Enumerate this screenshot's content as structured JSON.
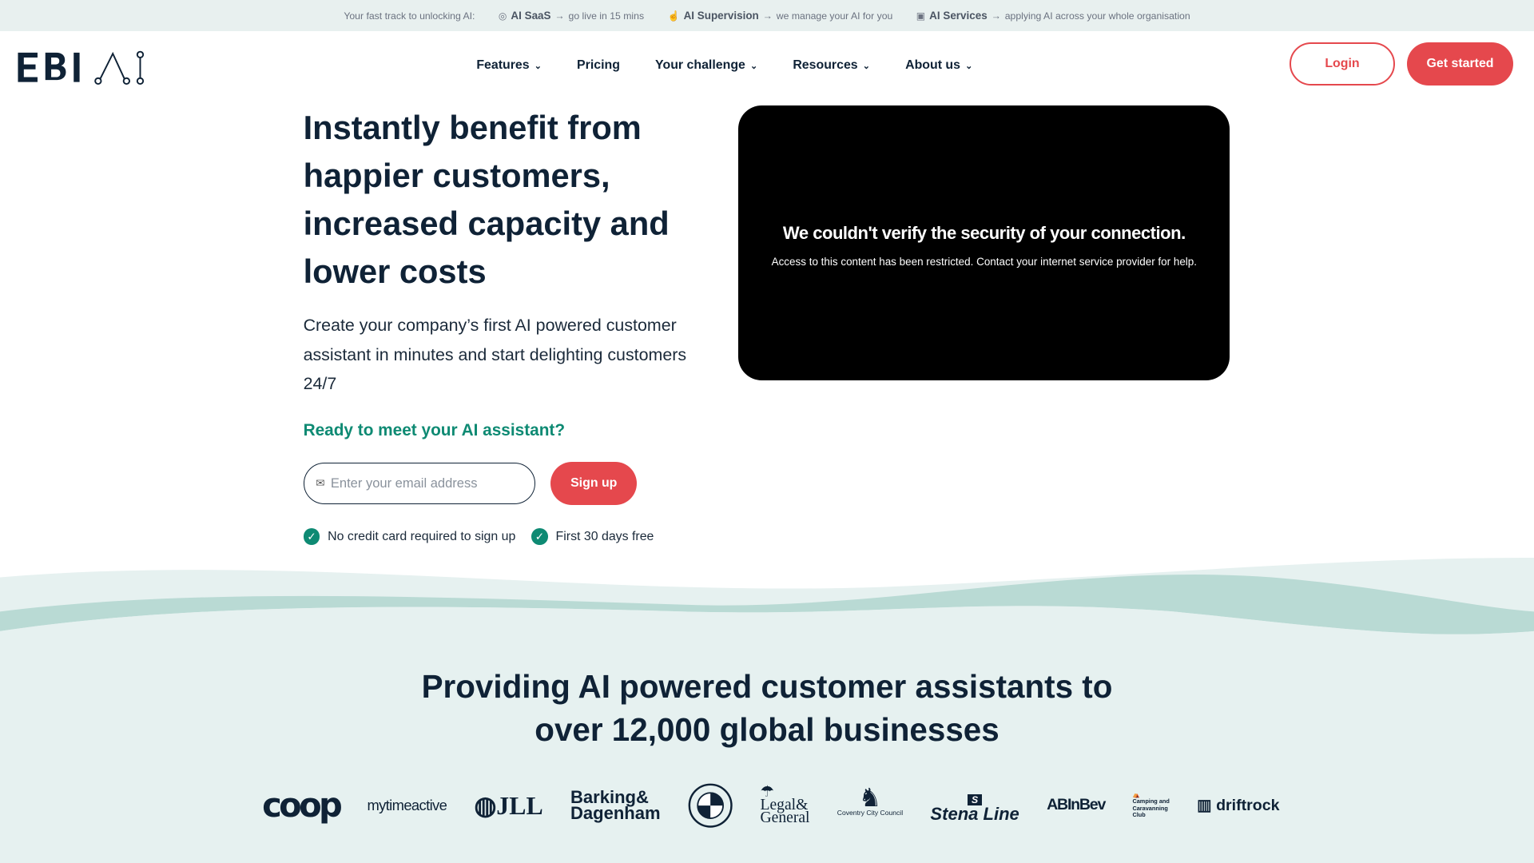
{
  "topbar": {
    "intro": "Your fast track to unlocking AI:",
    "items": [
      {
        "icon": "badge-check-icon",
        "title": "AI SaaS",
        "arrow": "→",
        "desc": "go live in 15 mins"
      },
      {
        "icon": "hand-user-icon",
        "title": "AI Supervision",
        "arrow": "→",
        "desc": "we manage your AI for you"
      },
      {
        "icon": "chip-icon",
        "title": "AI Services",
        "arrow": "→",
        "desc": "applying AI across your whole organisation"
      }
    ]
  },
  "brand": {
    "name": "EBI.AI"
  },
  "nav": [
    {
      "label": "Features",
      "dropdown": true
    },
    {
      "label": "Pricing",
      "dropdown": false
    },
    {
      "label": "Your challenge",
      "dropdown": true
    },
    {
      "label": "Resources",
      "dropdown": true
    },
    {
      "label": "About us",
      "dropdown": true
    }
  ],
  "header": {
    "login": "Login",
    "get_started": "Get started"
  },
  "hero": {
    "title": "Instantly benefit from happier customers, increased capacity and lower costs",
    "subtitle": "Create your company’s first AI powered customer assistant in minutes and start delighting customers 24/7",
    "cta_heading": "Ready to meet your AI assistant?",
    "email_placeholder": "Enter your email address",
    "signup": "Sign up",
    "checks": [
      "No credit card required to sign up",
      "First 30 days free"
    ]
  },
  "video": {
    "error_title": "We couldn't verify the security of your connection.",
    "error_text": "Access to this content has been restricted. Contact your internet service provider for help."
  },
  "customers": {
    "heading_line1": "Providing AI powered customer assistants to",
    "heading_line2": "over 12,000 global businesses",
    "logos": [
      "coop",
      "mytimeactive",
      "JLL",
      "Barking & Dagenham",
      "BMW",
      "Legal & General",
      "Coventry City Council",
      "Stena Line",
      "ABInBev",
      "The Camping and Caravanning Club",
      "driftrock"
    ]
  },
  "colors": {
    "navy": "#0f2236",
    "accent_red": "#e5484d",
    "teal": "#0e8a73",
    "band": "#e6f1f0"
  }
}
